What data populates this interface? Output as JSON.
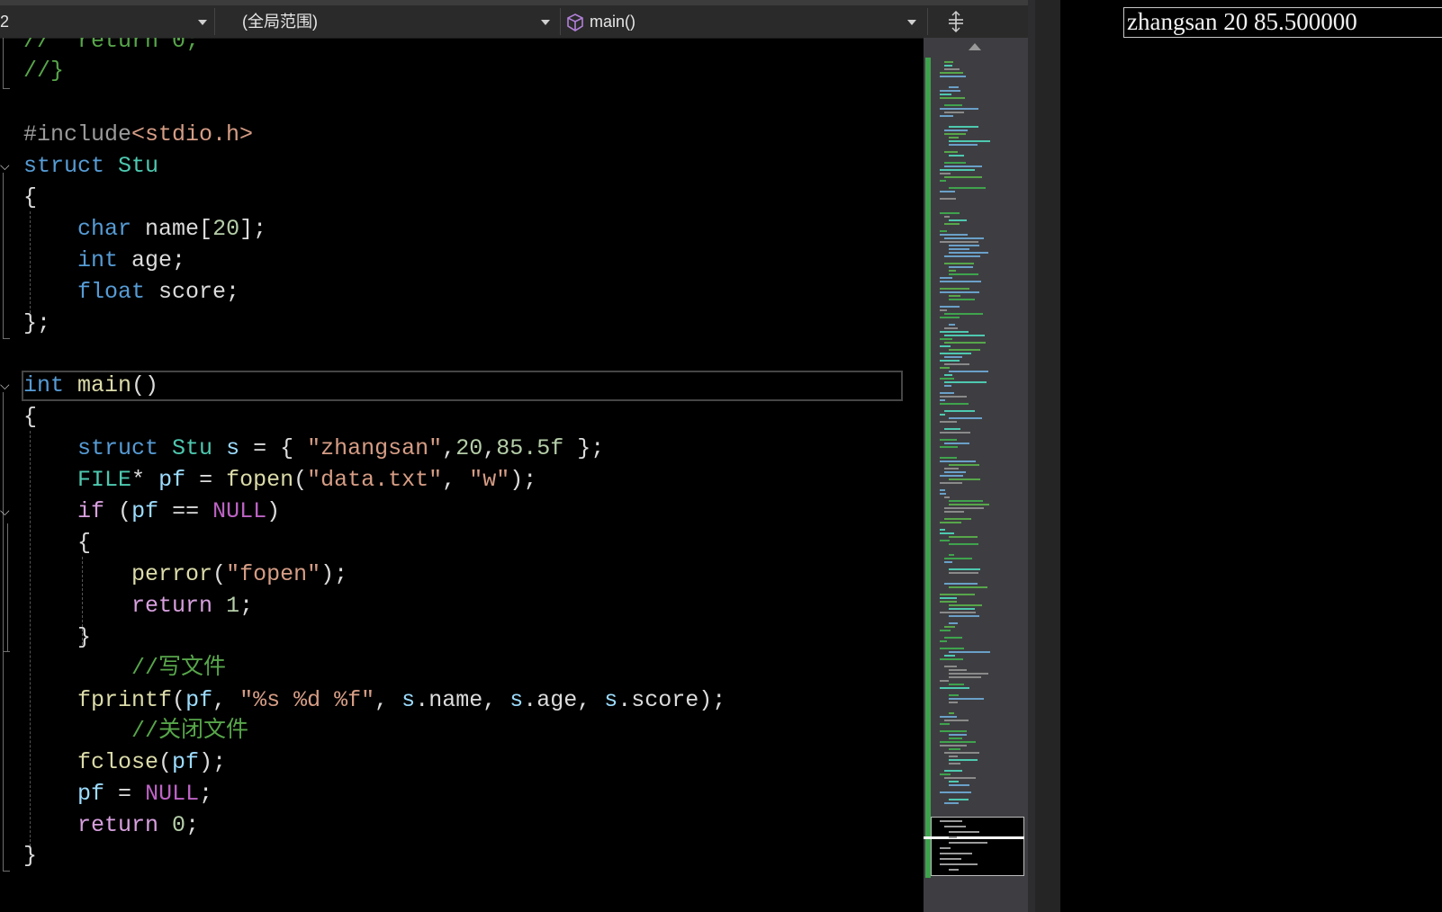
{
  "navbar": {
    "left_dropdown": "2",
    "scope_dropdown": "(全局范围)",
    "member_dropdown": "main()",
    "split_icon": "split-view-icon"
  },
  "code_lines": [
    "//  return 0;",
    "//}",
    "",
    "#include<stdio.h>",
    "struct Stu",
    "{",
    "    char name[20];",
    "    int age;",
    "    float score;",
    "};",
    "",
    "int main()",
    "{",
    "    struct Stu s = { \"zhangsan\",20,85.5f };",
    "    FILE* pf = fopen(\"data.txt\", \"w\");",
    "    if (pf == NULL)",
    "    {",
    "        perror(\"fopen\");",
    "        return 1;",
    "    }",
    "    //写文件",
    "    fprintf(pf, \"%s %d %f\", s.name, s.age, s.score);",
    "    //关闭文件",
    "    fclose(pf);",
    "    pf = NULL;",
    "    return 0;",
    "}"
  ],
  "output": {
    "text": "zhangsan 20 85.500000"
  },
  "colors": {
    "keyword": "#569cd6",
    "type": "#4ec9b0",
    "string": "#d69d85",
    "comment": "#57a64a",
    "function": "#dcdcaa",
    "variable": "#9cdcfe",
    "number": "#b5cea8",
    "control": "#d8a0df",
    "macro": "#bd63c5",
    "scroll_marker": "#3fa34d"
  }
}
